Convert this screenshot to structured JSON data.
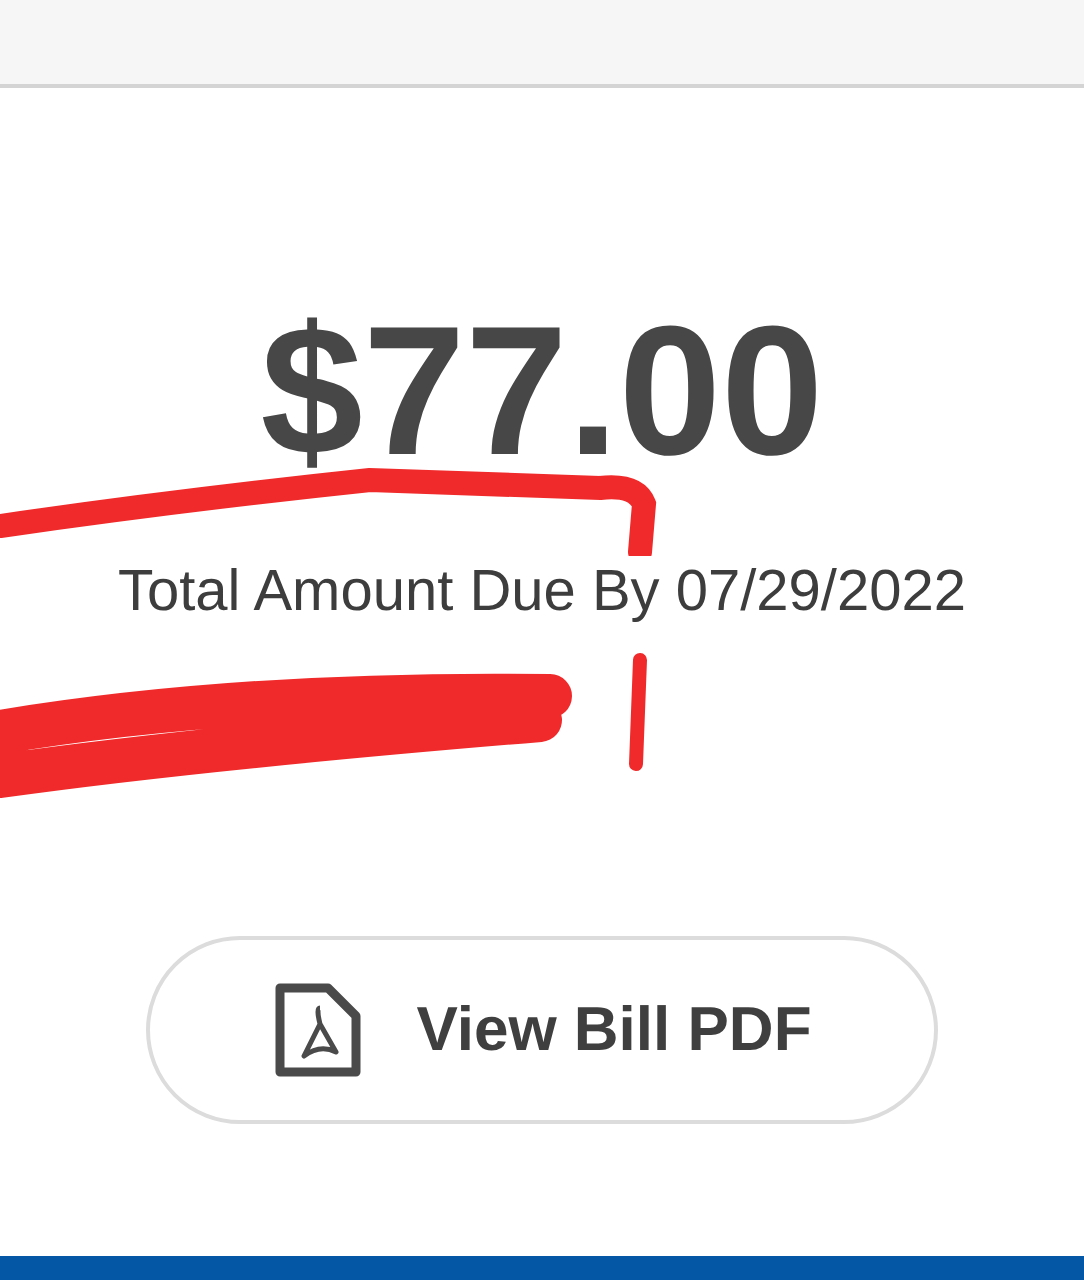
{
  "amount": "$77.00",
  "due_label": "Total Amount Due By 07/29/2022",
  "button": {
    "label": "View Bill PDF"
  }
}
